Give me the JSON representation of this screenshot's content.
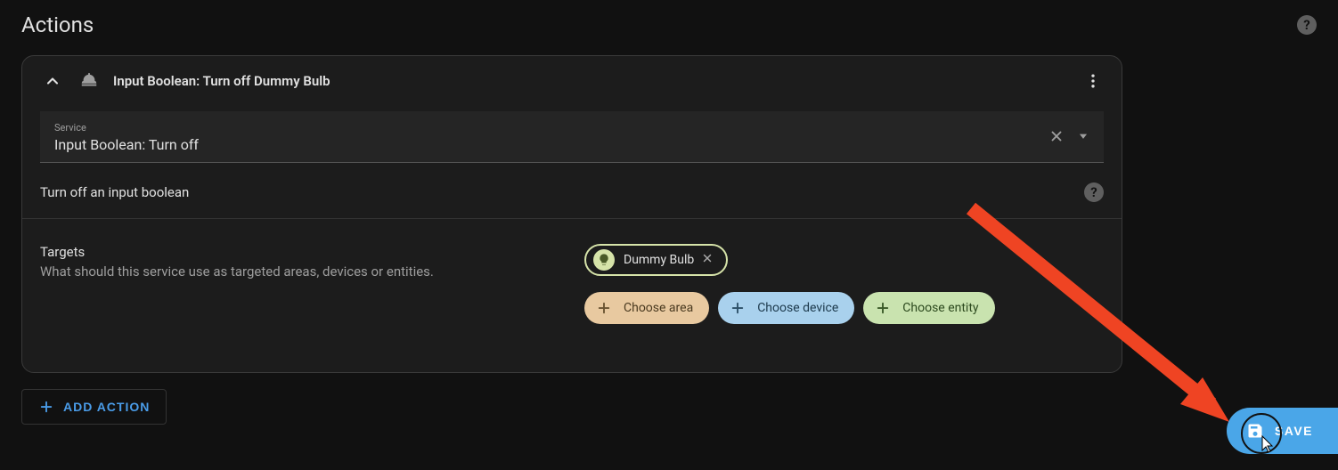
{
  "section": {
    "title": "Actions"
  },
  "action_card": {
    "title": "Input Boolean: Turn off Dummy Bulb",
    "service": {
      "label": "Service",
      "value": "Input Boolean: Turn off"
    },
    "description": "Turn off an input boolean",
    "targets": {
      "title": "Targets",
      "description": "What should this service use as targeted areas, devices or entities.",
      "selected_entity": "Dummy Bulb",
      "choose_area": "Choose area",
      "choose_device": "Choose device",
      "choose_entity": "Choose entity"
    }
  },
  "buttons": {
    "add_action": "ADD ACTION",
    "save": "SAVE"
  },
  "colors": {
    "chip_area": "#e8c9a0",
    "chip_device": "#a9d1ed",
    "chip_entity": "#c9e3af",
    "accent_blue": "#4aa6e8",
    "arrow_red": "#ef4423"
  }
}
